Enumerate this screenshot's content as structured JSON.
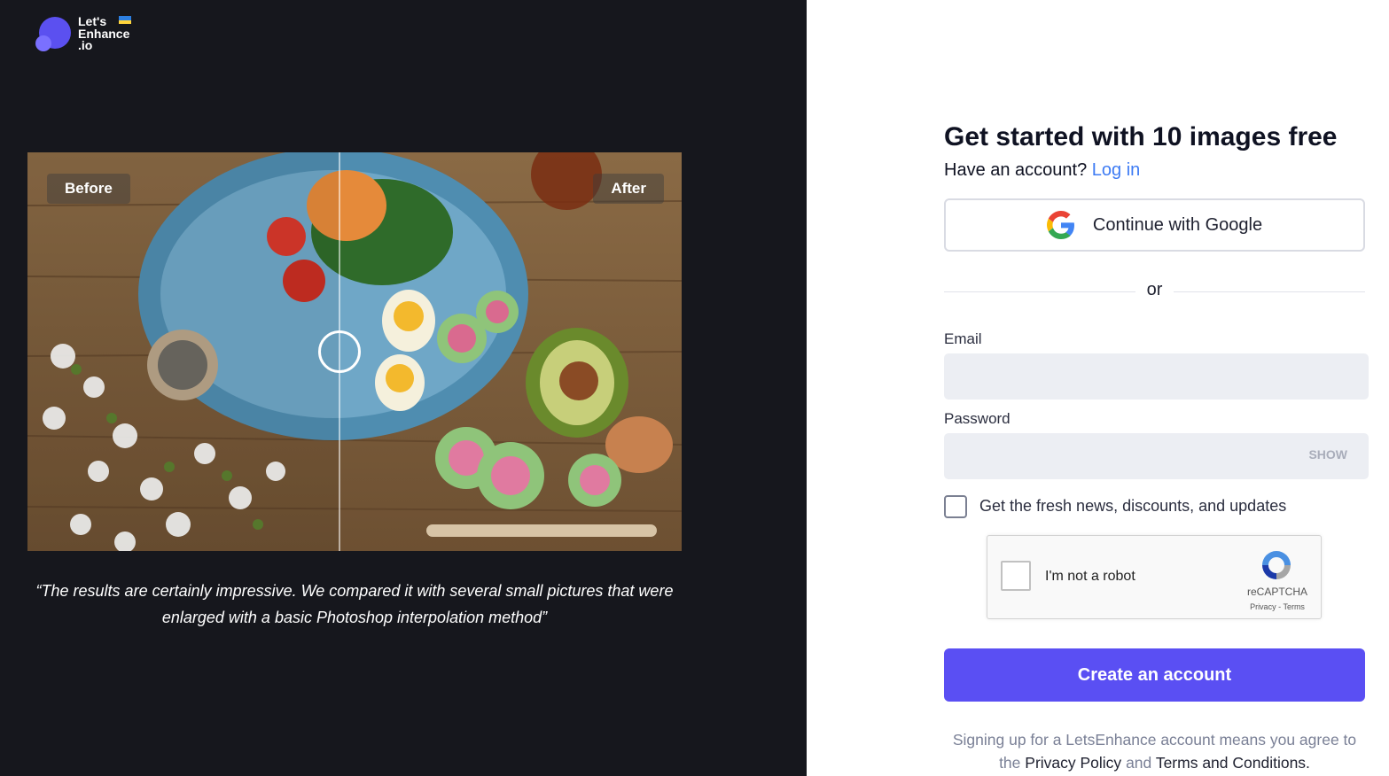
{
  "brand": {
    "logo_line1": "Let's",
    "logo_line2": "Enhance",
    "logo_line3": ".io",
    "accent": "#5a4ff3"
  },
  "showcase": {
    "before_label": "Before",
    "after_label": "After",
    "quote": "“The results are certainly impressive. We compared it with several small pictures that were enlarged with a basic Photoshop interpolation method”"
  },
  "signup": {
    "title": "Get started with 10 images free",
    "have_account": "Have an account?",
    "login_link": "Log in",
    "google_button": "Continue with Google",
    "divider_text": "or",
    "email_label": "Email",
    "email_value": "",
    "password_label": "Password",
    "password_value": "",
    "show_label": "SHOW",
    "newsletter_label": "Get the fresh news, discounts, and updates",
    "newsletter_checked": false,
    "captcha_label": "I'm not a robot",
    "captcha_brand": "reCAPTCHA",
    "captcha_privacy": "Privacy",
    "captcha_terms": "Terms",
    "create_button": "Create an account",
    "terms_prefix": "Signing up for a LetsEnhance account means you agree to the",
    "privacy_link": "Privacy Policy",
    "terms_and": "and",
    "conditions_link": "Terms and Conditions."
  }
}
